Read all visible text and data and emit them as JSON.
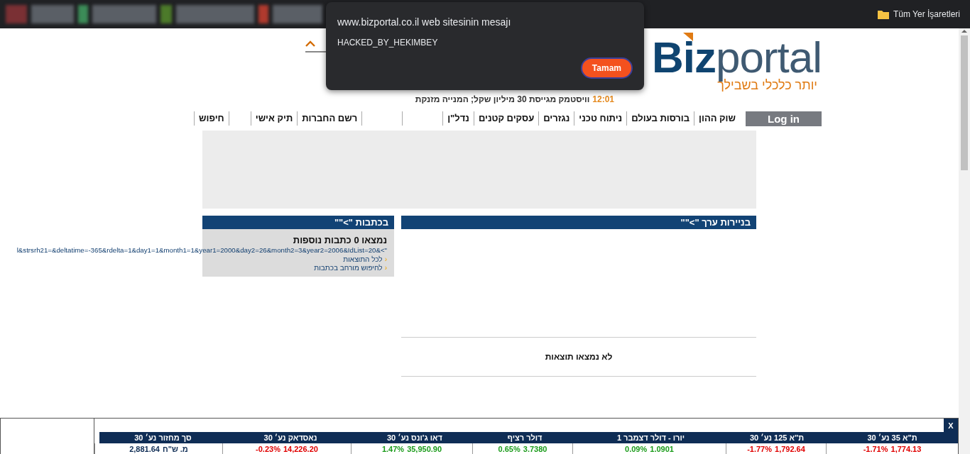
{
  "browser": {
    "bookmarks_label": "Tüm Yer İşaretleri"
  },
  "dialog": {
    "title": "www.bizportal.co.il web sitesinin mesajı",
    "message": "HACKED_BY_HEKIMBEY",
    "button": "Tamam"
  },
  "logo": {
    "brand_bold": "Biz",
    "brand_light": "portal",
    "tagline": "יותר כלכלי בשבילך"
  },
  "news_ticker": {
    "time": "12:01",
    "headline": "וויסטמק מגייסת 30 מיליון שקל; המנייה מזנקת"
  },
  "nav": {
    "login": "Log in",
    "items": [
      {
        "kind": "link",
        "label": "שוק ההון"
      },
      {
        "kind": "link",
        "label": "בורסות בעולם"
      },
      {
        "kind": "link",
        "label": "ניתוח טכני"
      },
      {
        "kind": "link",
        "label": "נגזרים"
      },
      {
        "kind": "link",
        "label": "עסקים קטנים"
      },
      {
        "kind": "link",
        "label": "נדל\"ן"
      },
      {
        "kind": "spacer"
      },
      {
        "kind": "spacer"
      },
      {
        "kind": "link",
        "label": "רשם החברות"
      },
      {
        "kind": "link",
        "label": "תיק אישי"
      },
      {
        "kind": "spacer"
      },
      {
        "kind": "link",
        "label": "חיפוש"
      }
    ]
  },
  "securities_panel": {
    "title": "בניירות ערך \">\"\"",
    "empty_message": "לא נמצאו תוצאות"
  },
  "articles_panel": {
    "title": "בכתבות \">\"\"",
    "summary": "נמצאו 0 כתבות נוספות",
    "query_text": "l&strsrh21=&deltatime=-365&rdelta=1&day1=1&month1=1&year1=2000&day2=26&month2=3&year2=2006&IdList=20&<\"",
    "links": [
      {
        "bullet": "‹",
        "label": "לכל התוצאות"
      },
      {
        "bullet": "‹",
        "label": "לחיפוש מורחב בכתבות"
      }
    ]
  },
  "market_ticker": {
    "close": "X",
    "columns": [
      {
        "kind": "index",
        "header": "ת\"א 35 נע׳ 30",
        "value": "1,774.13",
        "change": "-1.71%",
        "color": "#e00000"
      },
      {
        "kind": "index",
        "header": "ת\"א 125 נע׳ 30",
        "value": "1,792.64",
        "change": "-1.77%",
        "color": "#e00000"
      },
      {
        "kind": "index",
        "header": "יורו - דולר דצמבר 1",
        "value": "1.0901",
        "change": "0.09%",
        "color": "#1a9b1a"
      },
      {
        "kind": "index",
        "header": "דולר רציף",
        "value": "3.7380",
        "change": "0.65%",
        "color": "#1a9b1a"
      },
      {
        "kind": "index",
        "header": "דאו ג'ונס נע׳ 30",
        "value": "35,950.90",
        "change": "1.47%",
        "color": "#1a9b1a"
      },
      {
        "kind": "index",
        "header": "נאסדאק נע׳ 30",
        "value": "14,226.20",
        "change": "-0.23%",
        "color": "#e00000"
      },
      {
        "kind": "turnover",
        "header": "סך מחזור נע׳ 30",
        "value": "2,881.64",
        "unit": "מ. ש\"ח"
      }
    ]
  }
}
